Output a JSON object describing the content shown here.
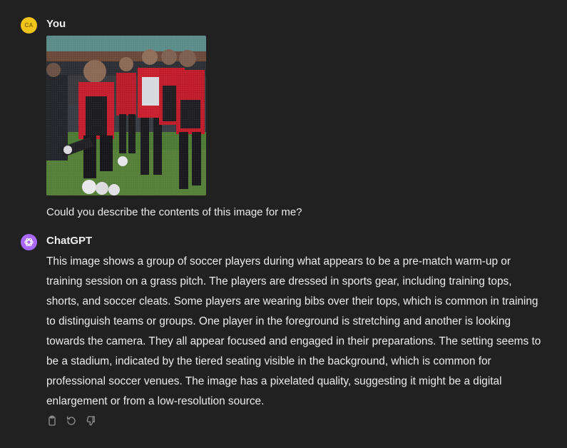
{
  "user_message": {
    "avatar_initials": "CA",
    "author": "You",
    "image": {
      "description_icon": "photo-soccer-players"
    },
    "text": "Could you describe the contents of this image for me?"
  },
  "assistant_message": {
    "author": "ChatGPT",
    "avatar_icon": "openai-logo-icon",
    "text": "This image shows a group of soccer players during what appears to be a pre-match warm-up or training session on a grass pitch. The players are dressed in sports gear, including training tops, shorts, and soccer cleats. Some players are wearing bibs over their tops, which is common in training to distinguish teams or groups. One player in the foreground is stretching and another is looking towards the camera. They all appear focused and engaged in their preparations. The setting seems to be a stadium, indicated by the tiered seating visible in the background, which is common for professional soccer venues. The image has a pixelated quality, suggesting it might be a digital enlargement or from a low-resolution source.",
    "actions": [
      {
        "icon": "copy-icon"
      },
      {
        "icon": "regenerate-icon"
      },
      {
        "icon": "thumbs-down-icon"
      }
    ]
  },
  "colors": {
    "background": "#212121",
    "text": "#ececec",
    "user_avatar": "#f0c419",
    "assistant_avatar": "#ab68ff",
    "action_icon": "#8e8e8e"
  }
}
